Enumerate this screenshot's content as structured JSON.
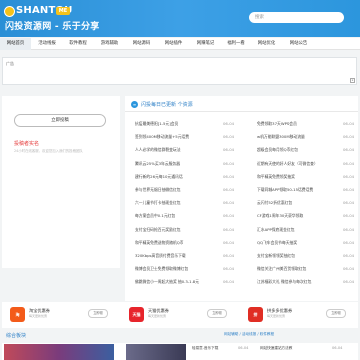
{
  "header": {
    "logo_en": "SHANTOU",
    "logo_badge": "ME",
    "logo_cn": "闪投资源网 - 乐于分享",
    "search_placeholder": "搜索"
  },
  "nav": {
    "items": [
      {
        "label": "网站首页",
        "active": true
      },
      {
        "label": "活动线报",
        "active": false
      },
      {
        "label": "软件教程",
        "active": false
      },
      {
        "label": "游戏辅助",
        "active": false
      },
      {
        "label": "网站源码",
        "active": false
      },
      {
        "label": "网站插件",
        "active": false
      },
      {
        "label": "网赚笔记",
        "active": false
      },
      {
        "label": "福利一看",
        "active": false
      },
      {
        "label": "网站优化",
        "active": false
      },
      {
        "label": "网站公告",
        "active": false
      }
    ]
  },
  "ad": {
    "label": "广告",
    "corner": "x"
  },
  "left": {
    "follow_button": "立即投稿",
    "recruit_title": "投稿者实名",
    "recruit_text": "24小时在线客服，欢迎您加入我们的投稿团队"
  },
  "news": {
    "icon": "≡",
    "title": "闪投每日已更新 个资源",
    "left": [
      {
        "title": "抗疫最美德阳[1-5元]会员",
        "date": "06-04"
      },
      {
        "title": "签到领400M移动流量+5元话费",
        "date": "06-04"
      },
      {
        "title": "人人必学的微信群裂变玩法",
        "date": "06-04"
      },
      {
        "title": "腾讯云25%买3年云服务器",
        "date": "06-04"
      },
      {
        "title": "建行新的26元每10元通讯话",
        "date": "06-04"
      },
      {
        "title": "参与世界无烟日抽微信红包",
        "date": "06-04"
      },
      {
        "title": "六一儿童节打卡抽现金红包",
        "date": "06-04"
      },
      {
        "title": "每方案会员中0.1元红包",
        "date": "06-04"
      },
      {
        "title": "支付宝扫码抢百元奖励红包",
        "date": "06-04"
      },
      {
        "title": "和平精英免费送物资随机Q币",
        "date": "06-04"
      },
      {
        "title": "320Kbps高音质付费音乐下载",
        "date": "06-04"
      },
      {
        "title": "微博会员卫士免费领取微博红包",
        "date": "06-04"
      },
      {
        "title": "佛跳微信小一周起大抽奖 抽0.3-1.8元",
        "date": "06-04"
      }
    ],
    "right": [
      {
        "title": "免费领取37天WPS会员",
        "date": "06-04"
      },
      {
        "title": "w机万能联盟300M移动流量",
        "date": "06-04"
      },
      {
        "title": "超级会员每月领Q币红包",
        "date": "06-04"
      },
      {
        "title": "近期有天使的好人好友（可微信查）",
        "date": "06-04"
      },
      {
        "title": "和平精英免费领奖抽奖",
        "date": "06-04"
      },
      {
        "title": "下载同城APP领取50-15话费话费",
        "date": "06-04"
      },
      {
        "title": "云闪付52折优惠红包",
        "date": "06-04"
      },
      {
        "title": "CF游戏1周年30天豪华领取",
        "date": "06-04"
      },
      {
        "title": "汇水APP保底现金红包",
        "date": "06-04"
      },
      {
        "title": "QQ飞车会员节每天抽奖",
        "date": "06-04"
      },
      {
        "title": "支付宝新领领奖抽红包",
        "date": "06-04"
      },
      {
        "title": "微信关注广州美百货领取红包",
        "date": "06-04"
      },
      {
        "title": "江苏福彩大礼 微信参与每次红包",
        "date": "06-04"
      }
    ]
  },
  "shops": [
    {
      "icon": "淘",
      "color": "#f35b1a",
      "title": "淘宝优惠券",
      "sub": "每天更新优惠",
      "btn": "立即领"
    },
    {
      "icon": "天猫",
      "color": "#e7252c",
      "title": "天猫优惠券",
      "sub": "每天更新优惠",
      "btn": "立即领"
    },
    {
      "icon": "拼",
      "color": "#e02e24",
      "title": "拼多多优惠券",
      "sub": "每天更新优惠",
      "btn": "立即领"
    }
  ],
  "section": {
    "title": "综合板块",
    "more": "网站辅助 / 活动线报 / 软件教程",
    "items": [
      {
        "title": "轻易意.音乐下载",
        "date": "06-04"
      },
      {
        "title": "网站快速建站方法教",
        "date": "06-04"
      }
    ]
  }
}
